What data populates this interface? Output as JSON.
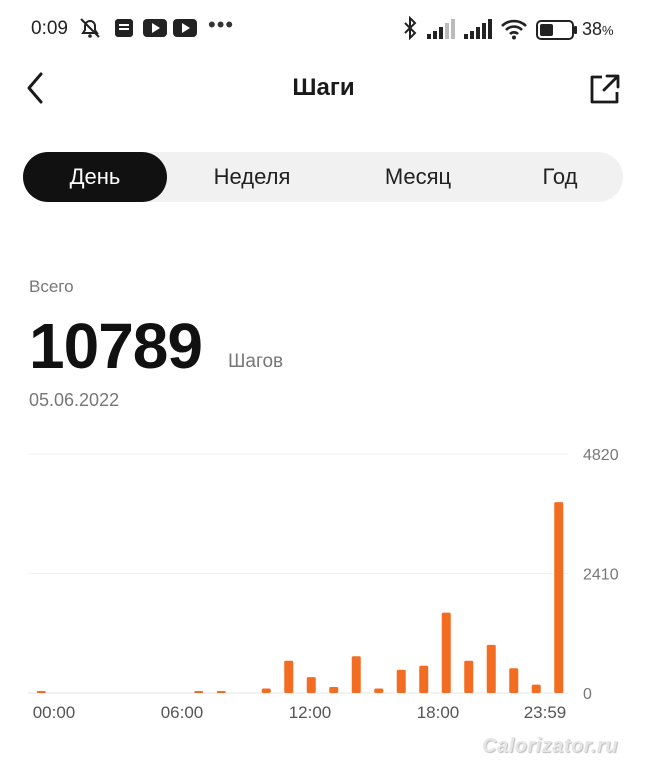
{
  "status_bar": {
    "time": "0:09",
    "battery_percent": "38",
    "battery_suffix": "%",
    "more": "•••",
    "icons": [
      "alarm-off-icon",
      "message-icon",
      "youtube-icon",
      "youtube-icon",
      "bluetooth-icon",
      "signal-icon",
      "signal-icon",
      "wifi-icon",
      "battery-icon"
    ]
  },
  "header": {
    "title": "Шаги",
    "back_icon": "chevron-left-icon",
    "share_icon": "share-external-icon"
  },
  "tabs": [
    {
      "label": "День",
      "active": true
    },
    {
      "label": "Неделя",
      "active": false
    },
    {
      "label": "Месяц",
      "active": false
    },
    {
      "label": "Год",
      "active": false
    }
  ],
  "summary": {
    "label": "Всего",
    "value": "10789",
    "unit": "Шагов",
    "date": "05.06.2022"
  },
  "chart_data": {
    "type": "bar",
    "x_tick_labels": [
      "00:00",
      "06:00",
      "12:00",
      "18:00",
      "23:59"
    ],
    "y_tick_labels": [
      "4820",
      "2410",
      "0"
    ],
    "ylim": [
      0,
      4820
    ],
    "grid": true,
    "color": "#f26d21",
    "x": [
      "00:00",
      "01:00",
      "02:00",
      "03:00",
      "04:00",
      "05:00",
      "06:00",
      "07:00",
      "08:00",
      "09:00",
      "10:00",
      "11:00",
      "12:00",
      "13:00",
      "14:00",
      "15:00",
      "16:00",
      "17:00",
      "18:00",
      "19:00",
      "20:00",
      "21:00",
      "22:00",
      "23:00"
    ],
    "values": [
      20,
      0,
      0,
      0,
      0,
      0,
      0,
      40,
      30,
      0,
      90,
      650,
      320,
      120,
      740,
      90,
      470,
      550,
      1620,
      650,
      970,
      500,
      170,
      3850
    ]
  },
  "watermark": "Calorizator.ru"
}
